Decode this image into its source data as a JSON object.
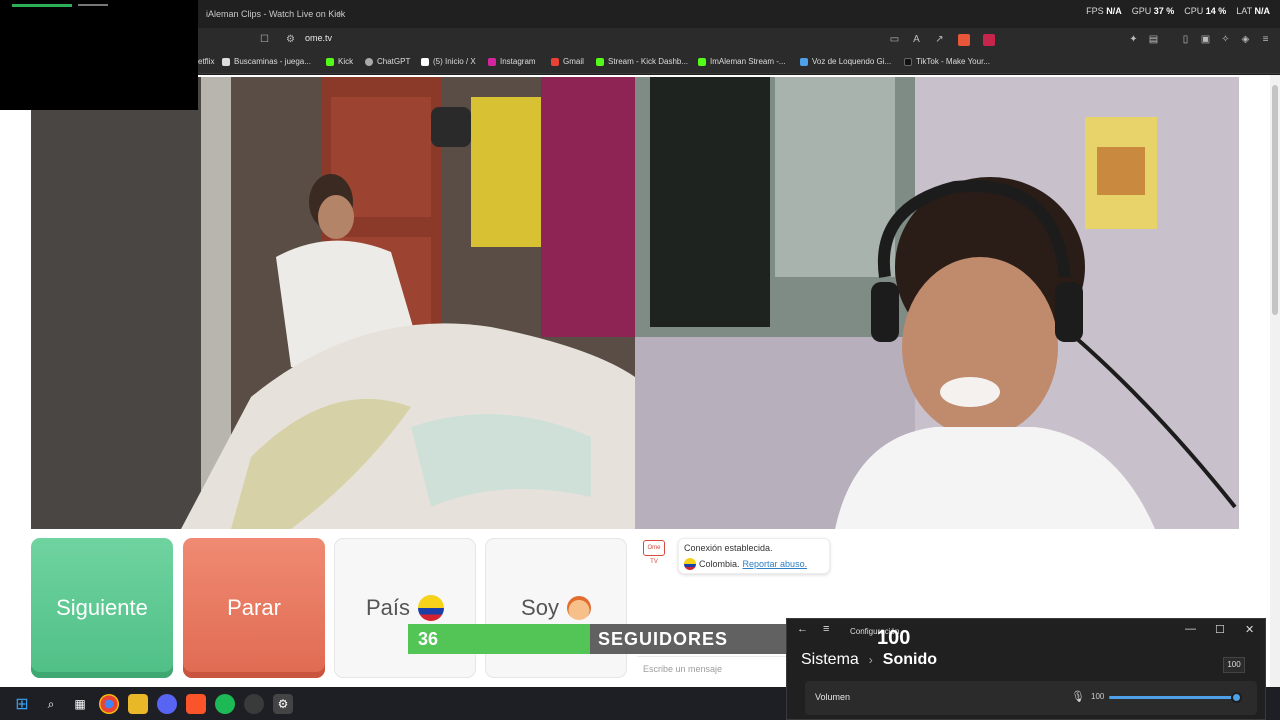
{
  "browser": {
    "tab_title": "iAleman Clips - Watch Live on Kick",
    "new_tab": "+",
    "url": "ome.tv"
  },
  "stats": {
    "fps_label": "FPS",
    "fps_value": "N/A",
    "gpu_label": "GPU",
    "gpu_value": "37 %",
    "cpu_label": "CPU",
    "cpu_value": "14 %",
    "lat_label": "LAT",
    "lat_value": "N/A"
  },
  "bookmarks": [
    "etflix",
    "Buscaminas - juega...",
    "Kick",
    "ChatGPT",
    "(5) Inicio / X",
    "Instagram",
    "Gmail",
    "Stream - Kick Dashb...",
    "ImAleman Stream -...",
    "Voz de Loquendo Gi...",
    "TikTok - Make Your..."
  ],
  "controls": {
    "next": "Siguiente",
    "stop": "Parar",
    "country": "País",
    "gender": "Soy"
  },
  "chat": {
    "logo": "Ome TV",
    "connected": "Conexión establecida.",
    "country": "Colombia.",
    "report": "Reportar abuso.",
    "input_placeholder": "Escribe un mensaje"
  },
  "followers": {
    "count": "36",
    "label": "SEGUIDORES"
  },
  "settings": {
    "title": "Configuración",
    "goal": "100",
    "breadcrumb_parent": "Sistema",
    "breadcrumb_current": "Sonido",
    "volume_label": "Volumen",
    "volume_value": "100",
    "volume_level": 1.0,
    "tooltip": "100"
  },
  "colors": {
    "next": "#4fbf86",
    "stop": "#e06a52",
    "followers_green": "#53c456",
    "accent": "#4ea0e8"
  }
}
